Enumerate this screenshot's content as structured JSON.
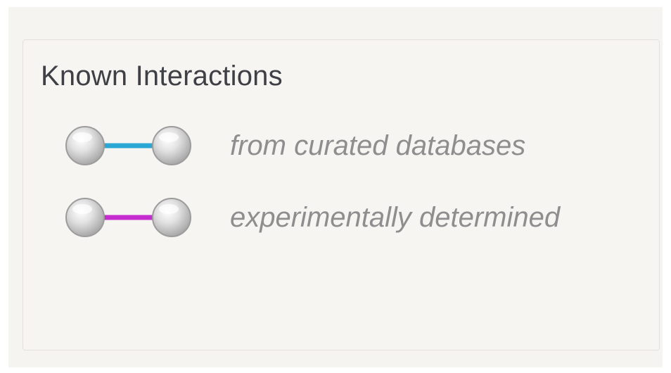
{
  "legend": {
    "title": "Known Interactions",
    "items": [
      {
        "label": "from curated databases",
        "edge_color": "#2aa7d4",
        "icon": "edge-node-pair-icon"
      },
      {
        "label": "experimentally determined",
        "edge_color": "#c42ccf",
        "icon": "edge-node-pair-icon"
      }
    ]
  },
  "colors": {
    "panel_background": "#f7f5f2",
    "title_text": "#3e4045",
    "label_text": "#8e8e8e",
    "node_fill": "#d6d6d6"
  }
}
